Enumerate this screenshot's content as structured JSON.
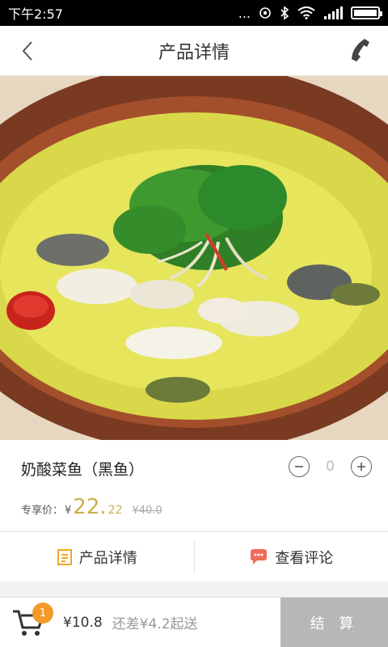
{
  "status_bar": {
    "time": "下午2:57",
    "indicators": "..."
  },
  "navbar": {
    "title": "产品详情"
  },
  "product": {
    "name": "奶酸菜鱼（黑鱼）",
    "quantity": "0",
    "price_label": "专享价：",
    "currency": "¥",
    "price_int": "22.",
    "price_dec": "22",
    "old_price": "¥40.0"
  },
  "tabs": [
    {
      "label": "产品详情",
      "icon": "document-icon"
    },
    {
      "label": "查看评论",
      "icon": "chat-icon"
    }
  ],
  "cart": {
    "badge_count": "1",
    "total": "¥10.8",
    "min_order_note": "还差¥4.2起送",
    "checkout_label": "结 算"
  },
  "colors": {
    "price": "#c9b04a",
    "badge": "#f39a2a",
    "checkout_bg": "#b7b7b7",
    "tab_icon_orange": "#f5a623",
    "tab_icon_red": "#f06a5a"
  }
}
